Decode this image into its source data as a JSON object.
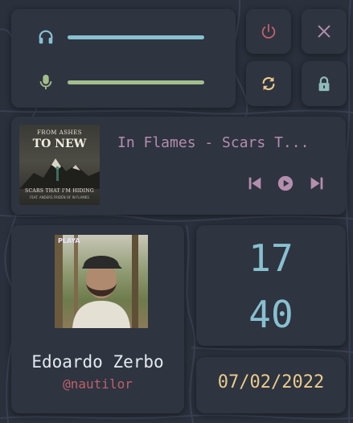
{
  "colors": {
    "background": "#2a303c",
    "card": "#2e3440",
    "volume_fill": "#88c0d0",
    "mic_fill": "#a3be8c",
    "power": "#bf616a",
    "accent_purple": "#b48ead",
    "clock": "#88c0d0",
    "date": "#ebcb8b",
    "handle": "#bf616a",
    "name": "#e5e9f0"
  },
  "sliders": {
    "volume": {
      "icon": "headphones-icon",
      "level": 1.0
    },
    "microphone": {
      "icon": "microphone-icon",
      "level": 1.0
    }
  },
  "buttons": {
    "power": {
      "icon": "power-icon"
    },
    "close": {
      "icon": "close-icon"
    },
    "refresh": {
      "icon": "refresh-icon"
    },
    "lock": {
      "icon": "lock-icon"
    }
  },
  "music": {
    "title": "In Flames - Scars T...",
    "album_art": {
      "band_top": "FROM ASHES",
      "band_bottom": "TO NEW",
      "song": "SCARS THAT I'M HIDING",
      "feat": "FEAT. ANDERS FRIDÉN OF IN FLAMES"
    },
    "controls": [
      "previous-icon",
      "play-icon",
      "next-icon"
    ]
  },
  "profile": {
    "avatar_tag": "PLAYA",
    "name": "Edoardo Zerbo",
    "handle": "@nautilor"
  },
  "clock": {
    "hours": "17",
    "minutes": "40"
  },
  "date": "07/02/2022"
}
